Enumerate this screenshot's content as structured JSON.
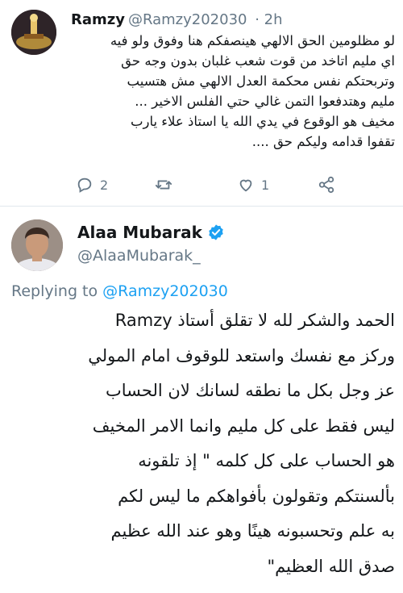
{
  "reply_tweet": {
    "name": "Ramzy",
    "handle": "@Ramzy202030",
    "time": "· 2h",
    "lines": [
      "لو مظلومين الحق الالهي هينصفكم هنا وفوق ولو فيه",
      "اي مليم اتاخد من قوت شعب غلبان بدون وجه حق",
      "وتربحتكم نفس محكمة العدل الالهي مش هتسيب",
      "مليم وهتدفعوا التمن غالي حتي الفلس الاخير ...",
      "مخيف هو الوقوع في يدي الله يا استاذ علاء يارب",
      "تقفوا قدامه وليكم حق ...."
    ],
    "actions": {
      "reply_count": "2",
      "retweet_count": "",
      "like_count": "1"
    }
  },
  "main_tweet": {
    "name": "Alaa Mubarak",
    "handle": "@AlaaMubarak_",
    "replying_prefix": "Replying to",
    "replying_to": "@Ramzy202030",
    "lines": [
      "الحمد والشكر لله لا تقلق أستاذ Ramzy",
      "وركز مع نفسك واستعد للوقوف امام المولي",
      "عز وجل بكل ما نطقه لسانك لان الحساب",
      "ليس فقط على كل مليم وانما الامر المخيف",
      "هو الحساب على كل كلمه \" إذ تلقونه",
      "بألسنتكم وتقولون بأفواهكم ما ليس لكم",
      "به علم وتحسبونه هينًا وهو عند الله عظيم",
      "صدق الله العظيم\""
    ]
  },
  "colors": {
    "text": "#14171a",
    "secondary": "#657786",
    "accent": "#1da1f2",
    "divider": "#e1e8ed"
  },
  "icons": [
    "reply-icon",
    "retweet-icon",
    "like-icon",
    "share-icon",
    "verified-badge-icon"
  ]
}
